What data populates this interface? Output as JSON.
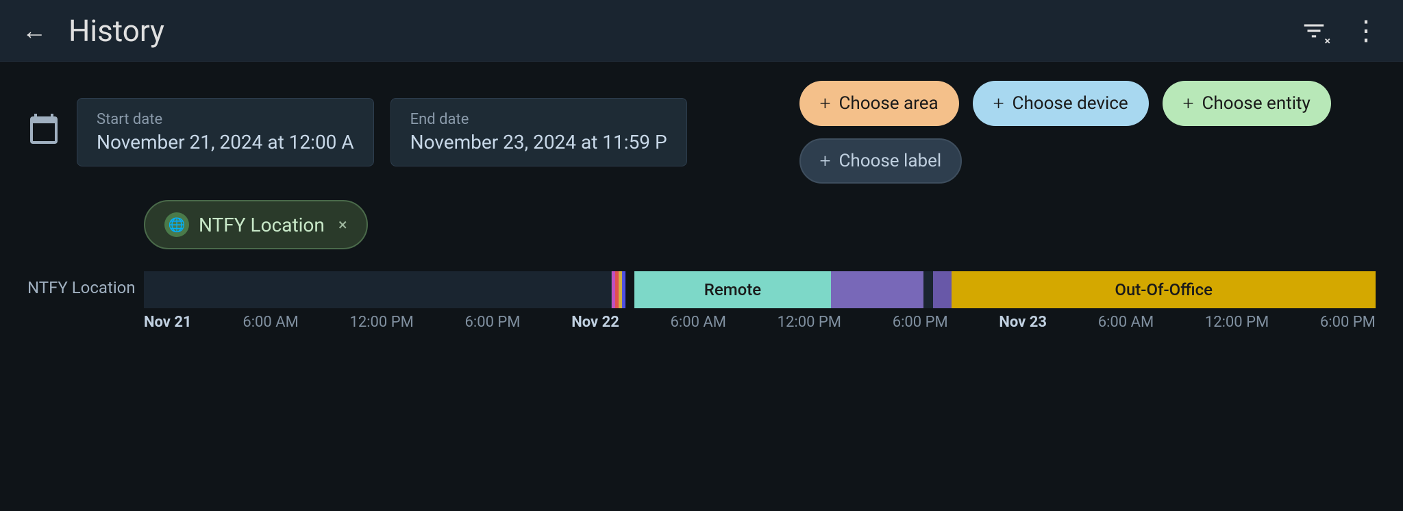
{
  "header": {
    "title": "History",
    "back_label": "←",
    "filter_icon": "▼",
    "filter_x": "×",
    "more_icon": "⋮"
  },
  "date_fields": {
    "start": {
      "label": "Start date",
      "value": "November 21, 2024 at 12:00 A"
    },
    "end": {
      "label": "End date",
      "value": "November 23, 2024 at 11:59 P"
    }
  },
  "chips": {
    "area": {
      "label": "Choose area",
      "plus": "+"
    },
    "device": {
      "label": "Choose device",
      "plus": "+"
    },
    "entity": {
      "label": "Choose entity",
      "plus": "+"
    },
    "label": {
      "label": "Choose label",
      "plus": "+"
    }
  },
  "active_entity": {
    "name": "NTFY Location",
    "close": "×",
    "icon": "🌐"
  },
  "timeline": {
    "row_label": "NTFY Location",
    "segments": {
      "remote_label": "Remote",
      "out_of_office_label": "Out-Of-Office"
    },
    "axis": [
      {
        "label": "Nov 21",
        "bold": true
      },
      {
        "label": "6:00 AM",
        "bold": false
      },
      {
        "label": "12:00 PM",
        "bold": false
      },
      {
        "label": "6:00 PM",
        "bold": false
      },
      {
        "label": "Nov 22",
        "bold": true
      },
      {
        "label": "6:00 AM",
        "bold": false
      },
      {
        "label": "12:00 PM",
        "bold": false
      },
      {
        "label": "6:00 PM",
        "bold": false
      },
      {
        "label": "Nov 23",
        "bold": true
      },
      {
        "label": "6:00 AM",
        "bold": false
      },
      {
        "label": "12:00 PM",
        "bold": false
      },
      {
        "label": "6:00 PM",
        "bold": false
      }
    ]
  }
}
